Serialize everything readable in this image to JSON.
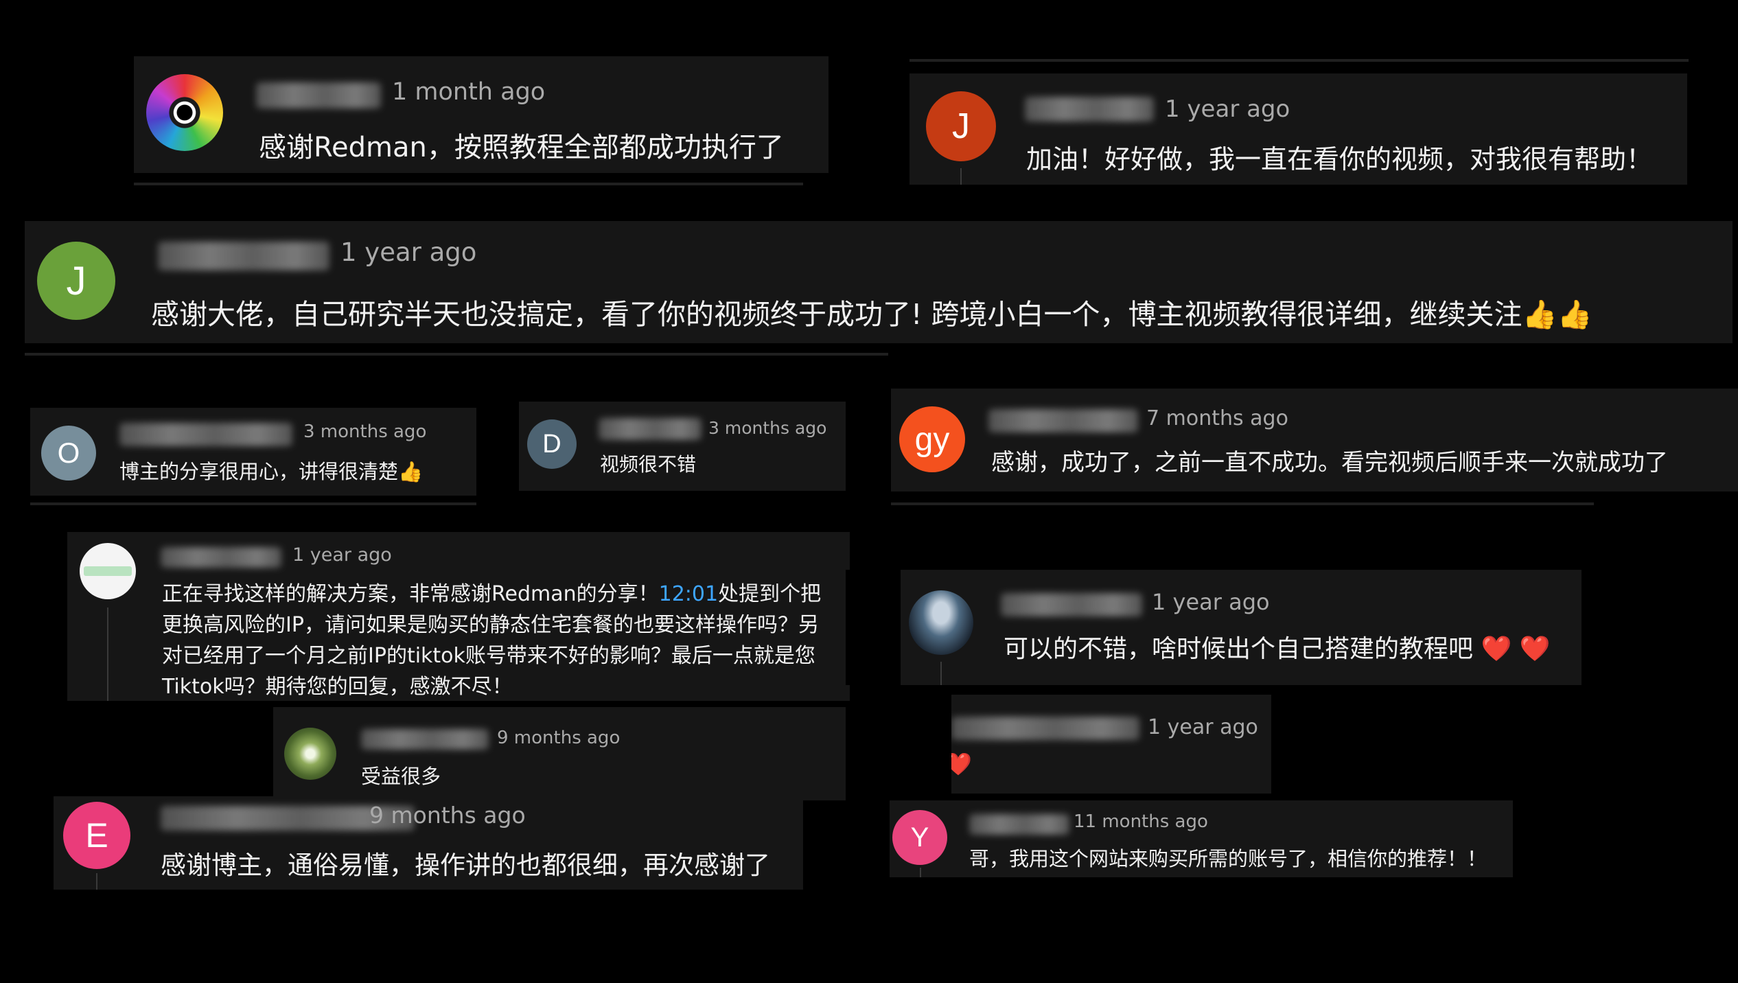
{
  "comments": [
    {
      "avatar_letter": "",
      "time": "1 month ago",
      "text": "感谢Redman，按照教程全部都成功执行了"
    },
    {
      "avatar_letter": "J",
      "time": "1 year ago",
      "text": "加油！好好做，我一直在看你的视频，对我很有帮助！"
    },
    {
      "avatar_letter": "J",
      "time": "1 year ago",
      "text": "感谢大佬，自己研究半天也没搞定，看了你的视频终于成功了! 跨境小白一个，博主视频教得很详细，继续关注👍👍"
    },
    {
      "avatar_letter": "O",
      "time": "3 months ago",
      "text": "博主的分享很用心，讲得很清楚👍"
    },
    {
      "avatar_letter": "D",
      "time": "3 months ago",
      "text": "视频很不错"
    },
    {
      "avatar_letter": "gy",
      "time": "7 months ago",
      "text": "感谢，成功了，之前一直不成功。看完视频后顺手来一次就成功了"
    },
    {
      "avatar_letter": "",
      "time": "1 year ago",
      "text_line1_a": "正在寻找这样的解决方案，非常感谢Redman的分享！",
      "timestamp_link": "12:01",
      "text_line1_b": "处提到个把",
      "text_line2": "更换高风险的IP，请问如果是购买的静态住宅套餐的也要这样操作吗？另",
      "text_line3": "对已经用了一个月之前IP的tiktok账号带来不好的影响？最后一点就是您",
      "text_line4": "Tiktok吗？期待您的回复，感激不尽！"
    },
    {
      "avatar_letter": "",
      "time": "1 year ago",
      "text": "可以的不错，啥时候出个自己搭建的教程吧",
      "hearts": "❤️ ❤️"
    },
    {
      "avatar_letter": "",
      "time": "9 months ago",
      "text": "受益很多"
    },
    {
      "avatar_letter": "",
      "time": "1 year ago",
      "hearts": "❤️"
    },
    {
      "avatar_letter": "E",
      "time": "9 months ago",
      "text": "感谢博主，通俗易懂，操作讲的也都很细，再次感谢了"
    },
    {
      "avatar_letter": "Y",
      "time": "11 months ago",
      "text": "哥，我用这个网站来购买所需的账号了，相信你的推荐！！"
    }
  ],
  "colors": {
    "background": "#000000",
    "card": "#161616",
    "timestamp_link": "#3ea6ff",
    "avatar_J1": "#c53b13",
    "avatar_J2": "#6aa13a",
    "avatar_O": "#778e9b",
    "avatar_D": "#4d6372",
    "avatar_gy": "#f4511e",
    "avatar_E": "#ea3c7a",
    "avatar_Y": "#e8447d"
  },
  "icons": [
    "eye-avatar-image",
    "landscape-avatar-image",
    "tree-avatar-image",
    "white-avatar-image",
    "thumbs-up-emoji",
    "red-heart-emoji"
  ]
}
